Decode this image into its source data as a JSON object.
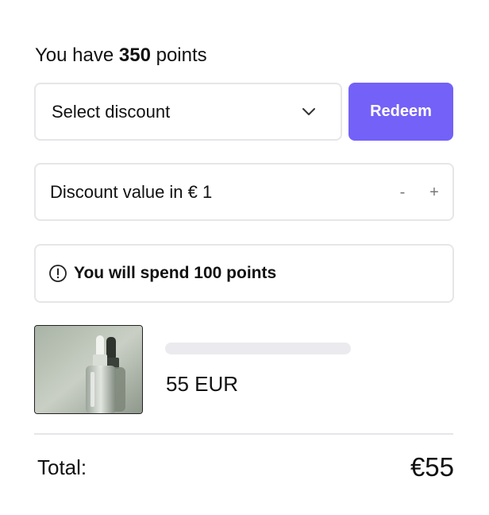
{
  "points": {
    "prefix": "You have",
    "amount": "350",
    "suffix": "points"
  },
  "discount_select": {
    "label": "Select discount",
    "icon": "chevron-down-icon"
  },
  "redeem_button": {
    "label": "Redeem",
    "color": "#7461f7"
  },
  "discount_value": {
    "label": "Discount value in € 1",
    "decrement_label": "-",
    "increment_label": "+"
  },
  "info": {
    "icon": "alert-circle-icon",
    "text": "You will spend 100 points"
  },
  "product": {
    "image": "serum-dropper-bottles-photo",
    "price": "55 EUR"
  },
  "total": {
    "label": "Total:",
    "value": "€55"
  }
}
